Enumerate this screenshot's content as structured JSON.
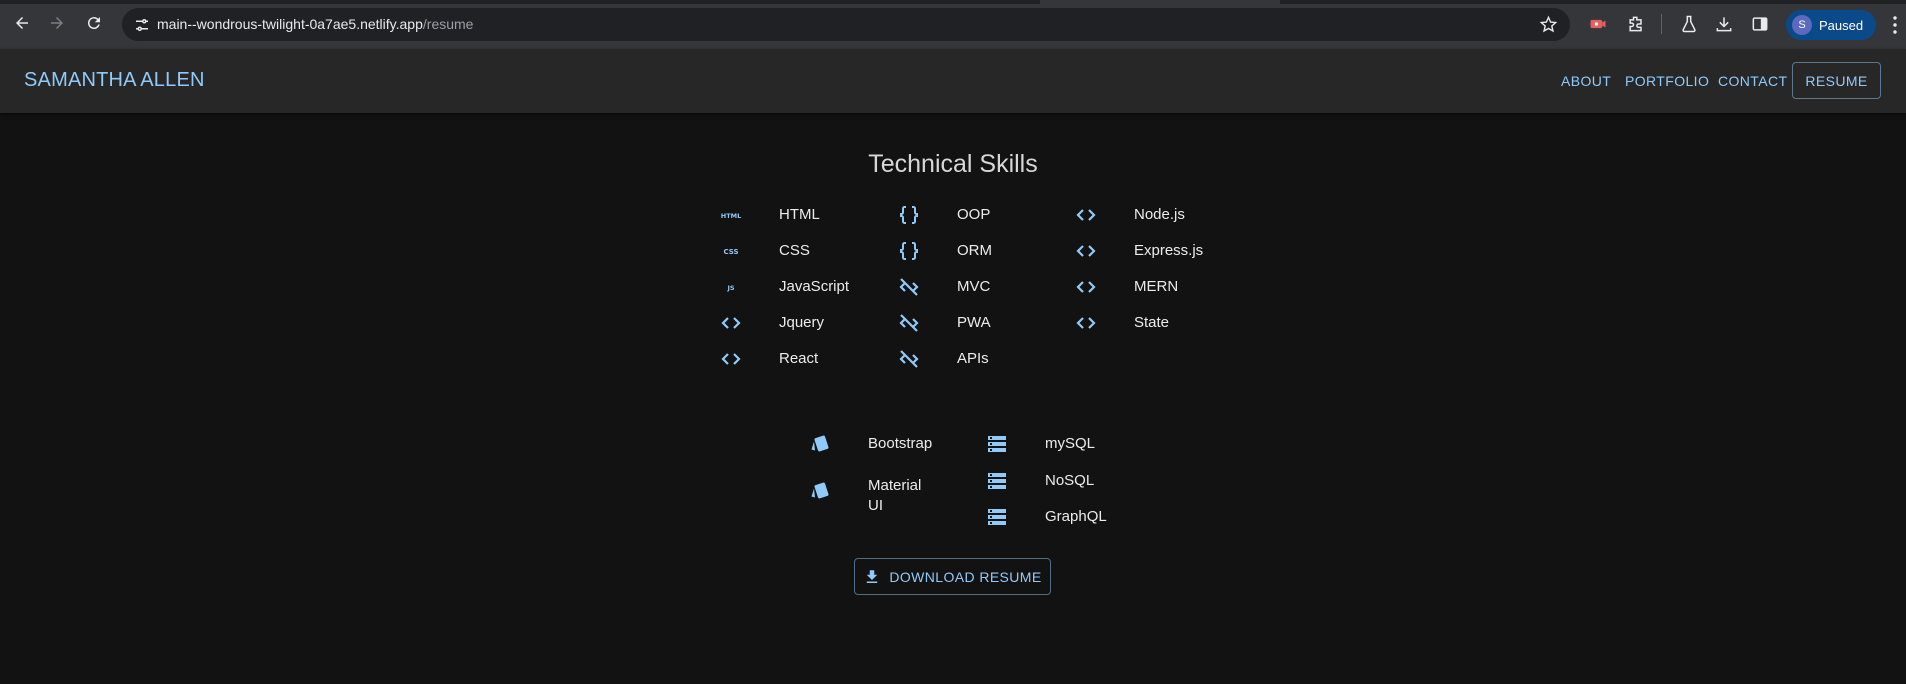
{
  "browser": {
    "url_host": "main--wondrous-twilight-0a7ae5.netlify.app",
    "url_path": "/resume",
    "profile_initial": "S",
    "profile_status": "Paused"
  },
  "appbar": {
    "brand": "SAMANTHA ALLEN",
    "nav": [
      "ABOUT",
      "PORTFOLIO",
      "CONTACT"
    ],
    "resume_label": "RESUME"
  },
  "skills": {
    "title": "Technical Skills",
    "col1": [
      {
        "label": "HTML",
        "icon": "html-icon"
      },
      {
        "label": "CSS",
        "icon": "css-icon"
      },
      {
        "label": "JavaScript",
        "icon": "js-icon"
      },
      {
        "label": "Jquery",
        "icon": "code-icon"
      },
      {
        "label": "React",
        "icon": "code-icon"
      }
    ],
    "col2": [
      {
        "label": "OOP",
        "icon": "data-object-icon"
      },
      {
        "label": "ORM",
        "icon": "data-object-icon"
      },
      {
        "label": "MVC",
        "icon": "code-off-icon"
      },
      {
        "label": "PWA",
        "icon": "code-off-icon"
      },
      {
        "label": "APIs",
        "icon": "code-off-icon"
      }
    ],
    "col3": [
      {
        "label": "Node.js",
        "icon": "code-icon"
      },
      {
        "label": "Express.js",
        "icon": "code-icon"
      },
      {
        "label": "MERN",
        "icon": "code-icon"
      },
      {
        "label": "State",
        "icon": "code-icon"
      }
    ],
    "frameworks": [
      {
        "label": "Bootstrap",
        "icon": "style-icon"
      },
      {
        "label": "Material UI",
        "icon": "style-icon"
      }
    ],
    "databases": [
      {
        "label": "mySQL",
        "icon": "storage-icon"
      },
      {
        "label": "NoSQL",
        "icon": "storage-icon"
      },
      {
        "label": "GraphQL",
        "icon": "storage-icon"
      }
    ]
  },
  "download_label": "DOWNLOAD RESUME",
  "colors": {
    "accent": "#90caf9",
    "background": "#121212",
    "appbar": "#272727"
  }
}
